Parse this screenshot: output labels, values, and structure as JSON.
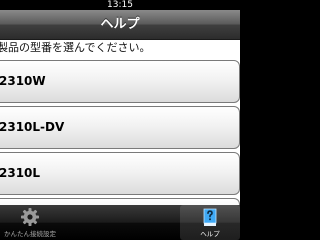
{
  "status_bar": {
    "time": "13:15"
  },
  "nav_bar": {
    "title": "ヘルプ"
  },
  "content": {
    "instruction": "製品の型番を選んでください。",
    "models": [
      {
        "label": "2310W"
      },
      {
        "label": "2310L-DV"
      },
      {
        "label": "2310L"
      },
      {
        "label": ""
      }
    ]
  },
  "tab_bar": {
    "tabs": [
      {
        "label": "かんたん接続設定",
        "icon": "gear-icon",
        "selected": false
      },
      {
        "label": "ヘルプ",
        "icon": "help-book-icon",
        "selected": true
      }
    ]
  },
  "colors": {
    "bar_dark": "#2c2c2c",
    "selected_icon": "#3fa9f5",
    "inactive_icon": "#9a9a9a"
  }
}
